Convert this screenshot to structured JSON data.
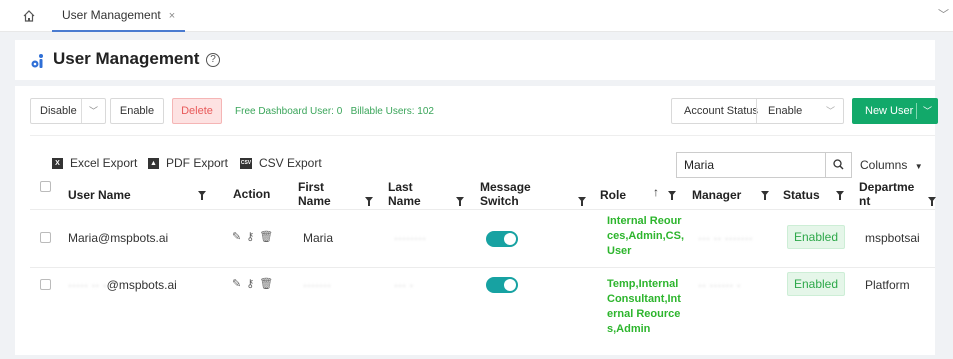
{
  "tabbar": {
    "tab_label": "User Management",
    "close_glyph": "×",
    "more_glyph": "﹀"
  },
  "header": {
    "title": "User Management",
    "help_glyph": "?"
  },
  "toolbar": {
    "disable_label": "Disable",
    "enable_label": "Enable",
    "delete_label": "Delete",
    "info_text": "Free Dashboard User: 0   Billable Users: 102",
    "account_status_label": "Account Status",
    "account_status_value": "Enable",
    "new_user_label": "New User",
    "colors": {
      "primary": "#12a96a",
      "danger": "#e85a5a",
      "toggle": "#17a2a2",
      "role_text": "#2db52d"
    }
  },
  "exports": {
    "excel": "Excel Export",
    "pdf": "PDF Export",
    "csv": "CSV Export",
    "csv_icon_text": "CSV"
  },
  "search": {
    "value": "Maria",
    "columns_label": "Columns"
  },
  "table": {
    "headers": {
      "user_name": "User Name",
      "action": "Action",
      "first_name": "First\nName",
      "last_name": "Last\nName",
      "message_switch": "Message\nSwitch",
      "role": "Role",
      "manager": "Manager",
      "status": "Status",
      "department": "Departme\nnt"
    },
    "rows": [
      {
        "user_name": "Maria@mspbots.ai",
        "first_name": "Maria",
        "last_name": "········",
        "message_switch": "on",
        "role": "Internal Reources,Admin,CS,User",
        "manager": "··· ·· ·······",
        "status": "Enabled",
        "department": "mspbotsai"
      },
      {
        "user_name": "@mspbots.ai",
        "user_name_prefix": "····· ·· ·",
        "first_name": "·······",
        "last_name": "··· ·",
        "message_switch": "on",
        "role": "Temp,Internal Consultant,Internal Reources,Admin",
        "manager": "·· ······ ·",
        "status": "Enabled",
        "department": "Platform"
      }
    ]
  }
}
